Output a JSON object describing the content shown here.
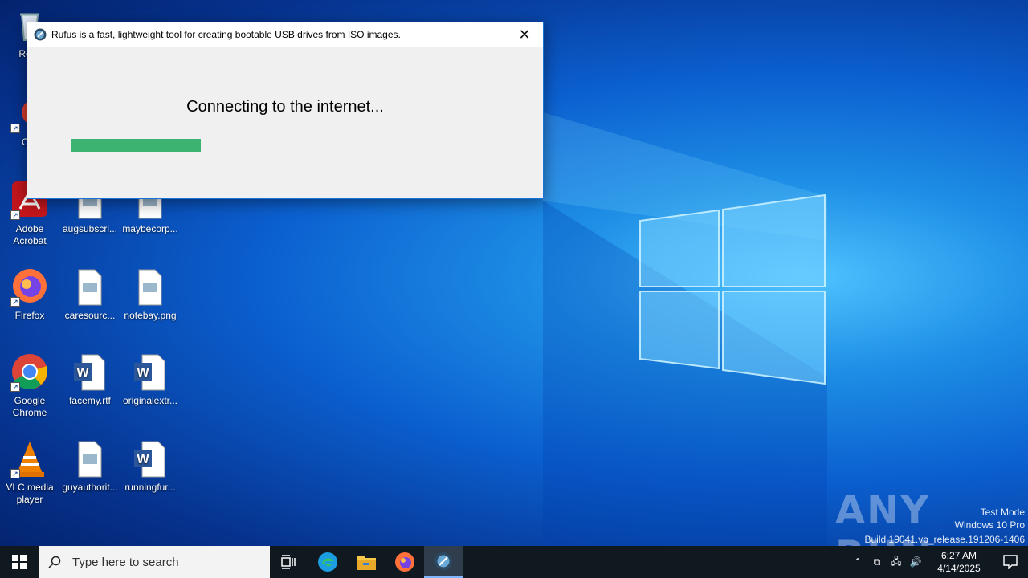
{
  "desktop": {
    "icons": [
      {
        "label": "Recy",
        "icon": "recycle-bin-icon"
      },
      {
        "label": "CCl",
        "icon": "ccleaner-icon"
      },
      {
        "label": "Adobe Acrobat",
        "icon": "acrobat-icon"
      },
      {
        "label": "Firefox",
        "icon": "firefox-icon"
      },
      {
        "label": "Google Chrome",
        "icon": "chrome-icon"
      },
      {
        "label": "VLC media player",
        "icon": "vlc-icon"
      },
      {
        "label": "augsubscri...",
        "icon": "image-file-icon"
      },
      {
        "label": "caresourc...",
        "icon": "image-file-icon"
      },
      {
        "label": "facemy.rtf",
        "icon": "word-document-icon"
      },
      {
        "label": "guyauthorit...",
        "icon": "image-file-icon"
      },
      {
        "label": "maybecorp...",
        "icon": "image-file-icon"
      },
      {
        "label": "notebay.png",
        "icon": "image-file-icon"
      },
      {
        "label": "originalextr...",
        "icon": "word-document-icon"
      },
      {
        "label": "runningfur...",
        "icon": "word-document-icon"
      }
    ]
  },
  "dialog": {
    "title": "Rufus is a fast, lightweight tool for creating bootable USB drives from ISO images.",
    "status": "Connecting to the internet...",
    "progress_percent": 30,
    "progress_color": "#3cb371"
  },
  "watermark": {
    "brand": "ANY RUN",
    "line1": "Test Mode",
    "line2": "Windows 10 Pro",
    "line3": "Build 19041.vb_release.191206-1406"
  },
  "taskbar": {
    "search_placeholder": "Type here to search",
    "time": "6:27 AM",
    "date": "4/14/2025",
    "apps": [
      "task-view-icon",
      "edge-icon",
      "file-explorer-icon",
      "firefox-icon",
      "rufus-icon"
    ]
  }
}
